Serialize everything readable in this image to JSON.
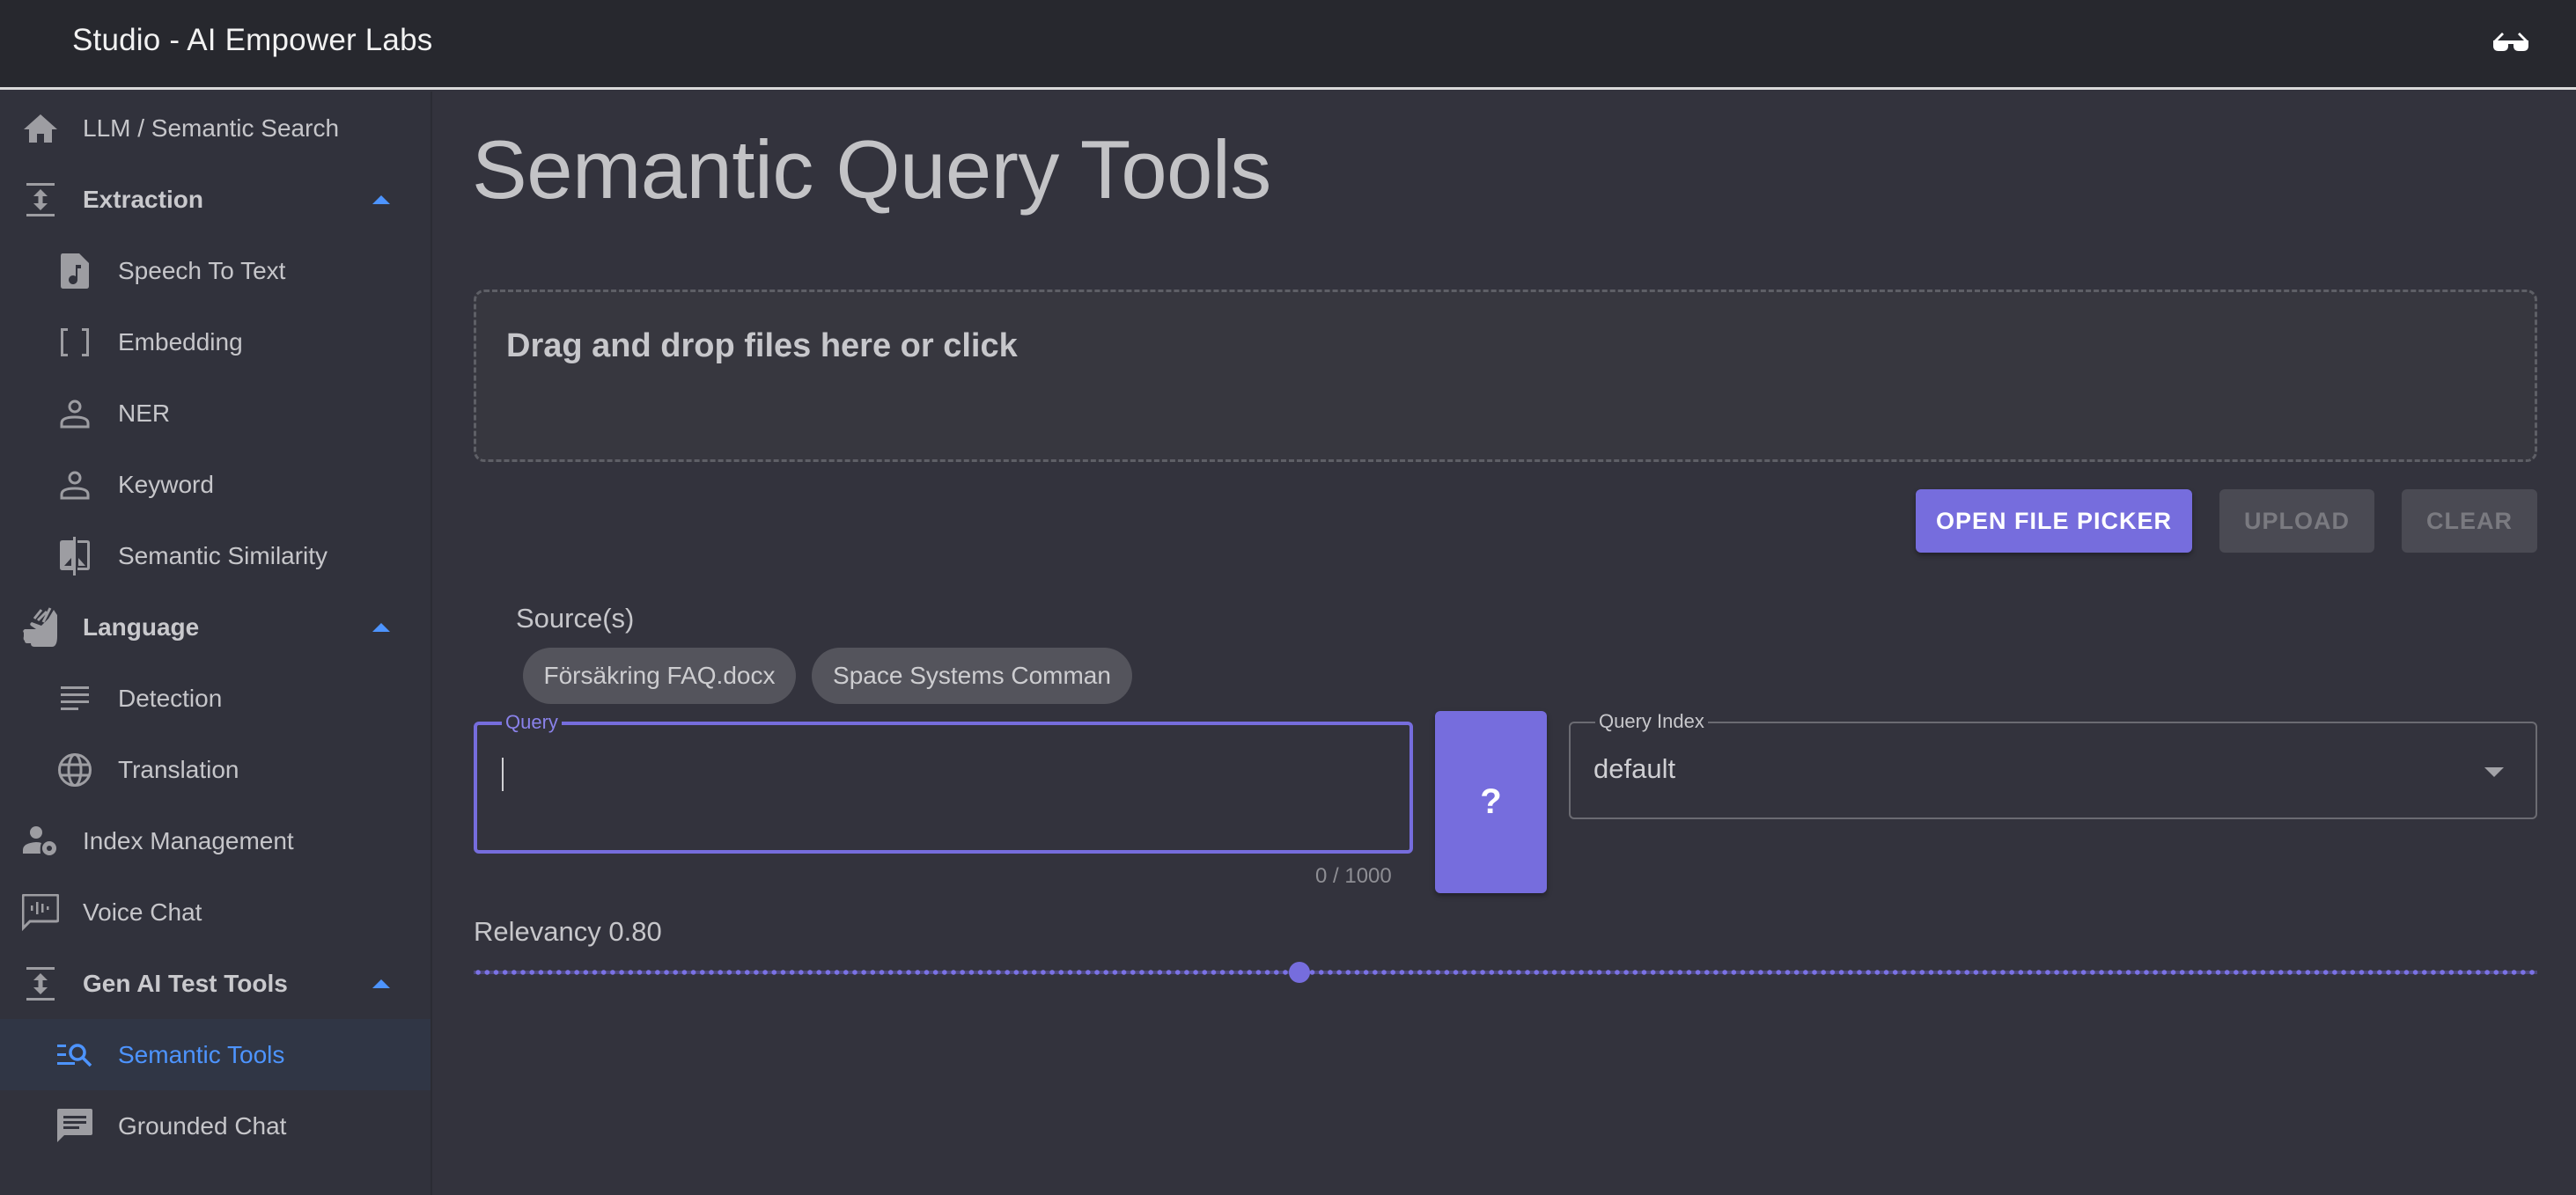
{
  "header": {
    "title": "Studio - AI Empower Labs",
    "right_icon": "sunglasses-icon"
  },
  "sidebar": {
    "items": [
      {
        "label": "LLM / Semantic Search",
        "icon": "home-icon",
        "level": "top",
        "group": false
      },
      {
        "label": "Extraction",
        "icon": "expand-vertical-icon",
        "level": "top",
        "group": true,
        "expanded": true
      },
      {
        "label": "Speech To Text",
        "icon": "audio-file-icon",
        "level": "sub"
      },
      {
        "label": "Embedding",
        "icon": "brackets-icon",
        "level": "sub"
      },
      {
        "label": "NER",
        "icon": "person-outline-icon",
        "level": "sub"
      },
      {
        "label": "Keyword",
        "icon": "person-outline-icon",
        "level": "sub"
      },
      {
        "label": "Semantic Similarity",
        "icon": "compare-icon",
        "level": "sub"
      },
      {
        "label": "Language",
        "icon": "sign-language-icon",
        "level": "top",
        "group": true,
        "expanded": true
      },
      {
        "label": "Detection",
        "icon": "notes-icon",
        "level": "sub"
      },
      {
        "label": "Translation",
        "icon": "globe-icon",
        "level": "sub"
      },
      {
        "label": "Index Management",
        "icon": "manage-accounts-icon",
        "level": "top",
        "group": false
      },
      {
        "label": "Voice Chat",
        "icon": "voice-chat-icon",
        "level": "top",
        "group": false
      },
      {
        "label": "Gen AI Test Tools",
        "icon": "expand-vertical-icon",
        "level": "top",
        "group": true,
        "expanded": true
      },
      {
        "label": "Semantic Tools",
        "icon": "manage-search-icon",
        "level": "sub",
        "active": true
      },
      {
        "label": "Grounded Chat",
        "icon": "chat-icon",
        "level": "sub"
      }
    ]
  },
  "main": {
    "title": "Semantic Query Tools",
    "dropzone_text": "Drag and drop files here or click",
    "buttons": {
      "open_file_picker": "OPEN FILE PICKER",
      "upload": "UPLOAD",
      "clear": "CLEAR"
    },
    "sources_label": "Source(s)",
    "sources": [
      "Försäkring FAQ.docx",
      "Space Systems Comman"
    ],
    "query": {
      "label": "Query",
      "value": "",
      "counter": "0 / 1000"
    },
    "ask_button": "?",
    "query_index": {
      "label": "Query Index",
      "selected": "default"
    },
    "relevancy": {
      "label": "Relevancy 0.80",
      "value": 0.8,
      "slider_fraction": 0.4
    }
  },
  "colors": {
    "accent": "#766ddd",
    "active_nav": "#4d94ff",
    "header_bg": "#27282e",
    "sidebar_bg": "#31323c",
    "main_bg": "#33333d"
  }
}
